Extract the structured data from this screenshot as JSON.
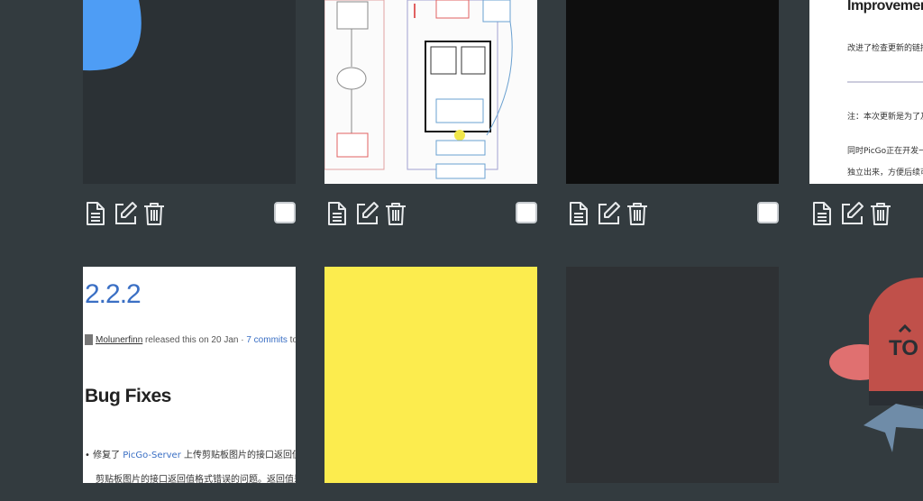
{
  "colors": {
    "background": "#333b3f",
    "toolbar_icon": "#e8eaec",
    "checkbox_fill": "#ffffff",
    "release_link": "#3a6fc4",
    "yellow_tile": "#fcec4e",
    "blue_blob": "#4e9df5",
    "mascot_red": "#c0504a"
  },
  "toolbar": {
    "icons": [
      "file-text-icon",
      "edit-icon",
      "trash-icon"
    ]
  },
  "cards": [
    {
      "kind": "blue-blob"
    },
    {
      "kind": "flowchart"
    },
    {
      "kind": "black"
    },
    {
      "kind": "document",
      "title": "Improvements",
      "lines": [
        "改进了检查更新的链接与备用",
        "注：本次更新是为了及时修复Serv",
        "同时PicGo正在开发一些新功能，",
        "独立出来，方便后续可以实现自"
      ]
    },
    {
      "kind": "release",
      "version": "2.2.2",
      "author": "Molunerfinn",
      "meta_mid": " released this on 20 Jan · ",
      "commits": "7 commits",
      "meta_tail": " to dev since this release",
      "heading": "Bug Fixes",
      "bullet_prefix": "• 修复了 ",
      "bullet_link": "PicGo-Server",
      "bullet_suffix": " 上传剪贴板图片的接口返回值格式错误的问题。现在通过 PicG",
      "bullet_line2": "剪贴板图片的接口返回值格式错误的问题。返回值是："
    },
    {
      "kind": "yellow"
    },
    {
      "kind": "dark"
    },
    {
      "kind": "mascot",
      "hat_text": "TO"
    }
  ]
}
